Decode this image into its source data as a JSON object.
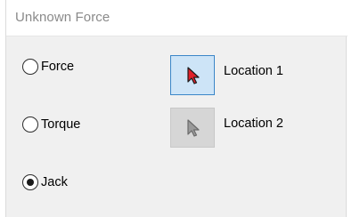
{
  "window": {
    "title": "Unknown Force"
  },
  "options": [
    {
      "label": "Force",
      "checked": false
    },
    {
      "label": "Torque",
      "checked": false
    },
    {
      "label": "Jack",
      "checked": true
    }
  ],
  "locations": [
    {
      "label": "Location 1",
      "active": true,
      "icon": "red-cursor-icon"
    },
    {
      "label": "Location 2",
      "active": false,
      "icon": "gray-cursor-icon"
    }
  ],
  "colors": {
    "active_button_bg": "#cde4f7",
    "active_button_border": "#3b86c8",
    "cursor_active_fill": "#e0202a",
    "cursor_inactive_fill": "#9a9a9a"
  }
}
